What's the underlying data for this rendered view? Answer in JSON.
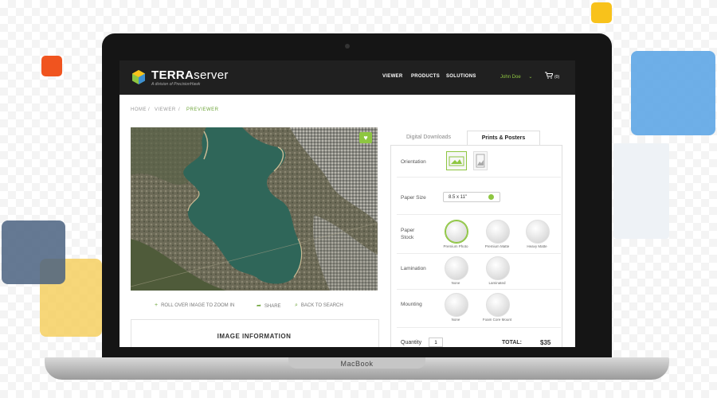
{
  "colors": {
    "accent": "#8ec641",
    "accent_dark": "#6ea53a",
    "topbar": "#202020"
  },
  "laptop": {
    "brand": "MacBook"
  },
  "header": {
    "logo_bold": "TERRA",
    "logo_light": "SERVER",
    "logo_sub": "A division of PrecisionHawk",
    "nav": [
      "VIEWER",
      "PRODUCTS",
      "SOLUTIONS"
    ],
    "user": "John Doe",
    "user_icon": "chevron-down-icon",
    "cart_icon": "cart-icon",
    "cart_count": "(0)"
  },
  "breadcrumb": {
    "home": "HOME",
    "viewer": "VIEWER",
    "current": "PREVIEWER"
  },
  "actions": {
    "zoom": "ROLL OVER IMAGE TO ZOOM IN",
    "share": "SHARE",
    "back": "BACK TO SEARCH"
  },
  "info": {
    "title": "IMAGE INFORMATION"
  },
  "tabs": {
    "digital": "Digital Downloads",
    "prints": "Prints & Posters"
  },
  "options": {
    "orientation_label": "Orientation",
    "paper_size_label": "Paper Size",
    "paper_size_value": "8.5 x 11\"",
    "paper_stock_label": "Paper\nStock",
    "stock": [
      "Premium Photo",
      "Premium Matte",
      "Heavy Matte"
    ],
    "lamination_label": "Lamination",
    "lamination": [
      "None",
      "Laminated"
    ],
    "mounting_label": "Mounting",
    "mounting": [
      "None",
      "Foam Core Mount"
    ],
    "quantity_label": "Quantity",
    "quantity_value": "1",
    "total_label": "TOTAL:",
    "total_value": "$35"
  }
}
